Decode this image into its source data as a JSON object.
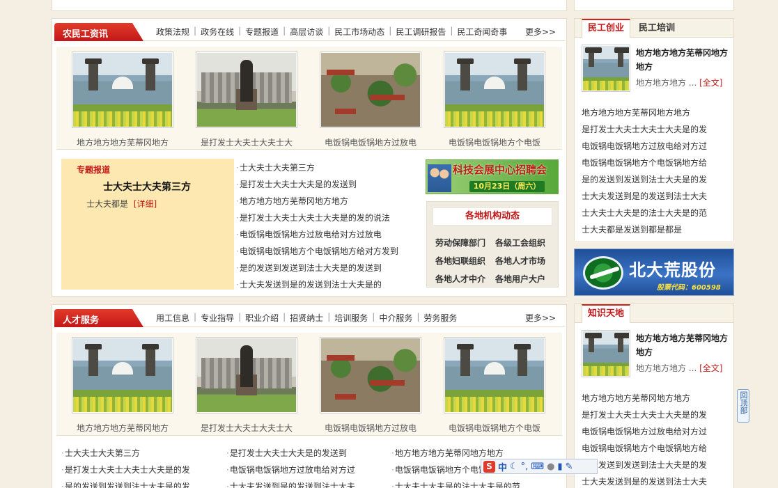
{
  "section_news": {
    "title": "农民工资讯",
    "nav": [
      "政策法规",
      "政务在线",
      "专题报道",
      "高层访谈",
      "民工市场动态",
      "民工调研报告",
      "民工奇闻奇事"
    ],
    "more": "更多>>",
    "photos": [
      {
        "caption": "地方地方地方芜蒂冈地方",
        "icon": "park-photo"
      },
      {
        "caption": "是打发士大夫士大夫士大",
        "icon": "station-photo"
      },
      {
        "caption": "电饭锅电饭锅地方过放电",
        "icon": "garden-photo"
      },
      {
        "caption": "电饭锅电饭锅地方个电饭",
        "icon": "park-photo"
      }
    ]
  },
  "feature": {
    "label": "专题报道",
    "headline": "士大夫士大夫第三方",
    "summary": "士大夫都是",
    "detail_link": "[详细]"
  },
  "news_list": [
    "士大夫士大夫第三方",
    "是打发士大夫士大夫是的发送到",
    "地方地方地方芜蒂冈地方地方",
    "是打发士大夫士大夫士大夫是的发的说法",
    "电饭锅电饭锅地方过放电给对方过放电",
    "电饭锅电饭锅地方个电饭锅地方给对方发到",
    "是的发送到发送到法士大夫是的发送到",
    "士大夫发送到是的发送到法士大夫是的"
  ],
  "banner_ad": {
    "text": "科技会展中心招聘会",
    "date": "10月23日（周六）"
  },
  "org_panel": {
    "title": "各地机构动态",
    "links": [
      "劳动保障部门",
      "各级工会组织",
      "各地妇联组织",
      "各地人才市场",
      "各地人才中介",
      "各地用户大户"
    ]
  },
  "section_talent": {
    "title": "人才服务",
    "nav": [
      "用工信息",
      "专业指导",
      "职业介绍",
      "招贤纳士",
      "培训服务",
      "中介服务",
      "劳务服务"
    ],
    "more": "更多>>",
    "photos": [
      {
        "caption": "地方地方地方芜蒂冈地方",
        "icon": "park-photo"
      },
      {
        "caption": "是打发士大夫士大夫士大",
        "icon": "station-photo"
      },
      {
        "caption": "电饭锅电饭锅地方过放电",
        "icon": "garden-photo"
      },
      {
        "caption": "电饭锅电饭锅地方个电饭",
        "icon": "park-photo"
      }
    ],
    "list_col1": [
      "士大夫士大夫第三方",
      "是打发士大夫士大夫士大夫是的发",
      "是的发送到发送到法士大夫是的发"
    ],
    "list_col2": [
      "是打发士大夫士大夫是的发送到",
      "电饭锅电饭锅地方过放电给对方过",
      "士大夫发送到是的发送到法士大夫"
    ],
    "list_col3": [
      "地方地方地方芜蒂冈地方地方",
      "电饭锅电饭锅地方个电饭锅地方给",
      "士大夫士大夫是的法士大夫是的范"
    ]
  },
  "sidebar_startup": {
    "tabs": [
      "民工创业",
      "民工培训"
    ],
    "thumb_title": "地方地方地方芜蒂冈地方地方",
    "thumb_summary": "地方地方地方 ...",
    "full_link": "[全文]",
    "list": [
      "地方地方地方芜蒂冈地方地方",
      "是打发士大夫士大夫士大夫是的发",
      "电饭锅电饭锅地方过放电给对方过",
      "电饭锅电饭锅地方个电饭锅地方给",
      "是的发送到发送到法士大夫是的发",
      "士大夫发送到是的发送到法士大夫",
      "士大夫士大夫是的法士大夫是的范",
      "士大夫都是发送到都是都是"
    ]
  },
  "sidebar_banner": {
    "name": "北大荒股份",
    "stock_code": "股票代码：600598"
  },
  "sidebar_knowledge": {
    "tabs": [
      "知识天地"
    ],
    "thumb_title": "地方地方地方芜蒂冈地方地方",
    "thumb_summary": "地方地方地方 ...",
    "full_link": "[全文]",
    "list": [
      "地方地方地方芜蒂冈地方地方",
      "是打发士大夫士大夫士大夫是的发",
      "电饭锅电饭锅地方过放电给对方过",
      "电饭锅电饭锅地方个电饭锅地方给",
      "是的发送到发送到法士大夫是的发",
      "士大夫发送到是的发送到法士大夫"
    ]
  },
  "back_to_top": "回顶部",
  "ime_toolbar": {
    "mode": "中"
  },
  "colors": {
    "accent_red": "#c31818",
    "page_bg": "#f4efe2",
    "feature_bg": "#fce8b0"
  }
}
